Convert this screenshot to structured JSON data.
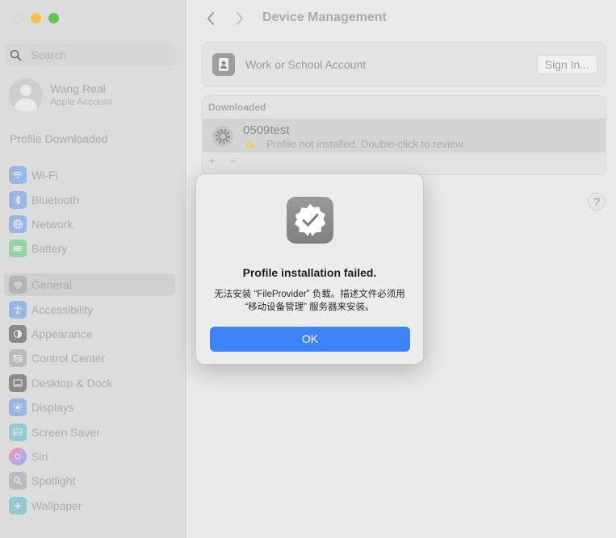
{
  "sidebar": {
    "search_placeholder": "Search",
    "account_name": "Wang Real",
    "account_sub": "Apple Account",
    "profile_downloaded": "Profile Downloaded",
    "items": [
      {
        "label": "Wi-Fi",
        "icon": "wifi-icon",
        "color": "#3b82f6"
      },
      {
        "label": "Bluetooth",
        "icon": "bluetooth-icon",
        "color": "#3b82f6"
      },
      {
        "label": "Network",
        "icon": "globe-icon",
        "color": "#3b82f6"
      },
      {
        "label": "Battery",
        "icon": "battery-icon",
        "color": "#34c759"
      },
      {
        "label": "General",
        "icon": "gear-icon",
        "color": "#8e8e93"
      },
      {
        "label": "Accessibility",
        "icon": "accessibility-icon",
        "color": "#3b82f6"
      },
      {
        "label": "Appearance",
        "icon": "appearance-icon",
        "color": "#1c1c1e"
      },
      {
        "label": "Control Center",
        "icon": "control-center-icon",
        "color": "#8e8e93"
      },
      {
        "label": "Desktop & Dock",
        "icon": "dock-icon",
        "color": "#1c1c1e"
      },
      {
        "label": "Displays",
        "icon": "sun-icon",
        "color": "#3b82f6"
      },
      {
        "label": "Screen Saver",
        "icon": "screen-saver-icon",
        "color": "#30b0c7"
      },
      {
        "label": "Siri",
        "icon": "siri-icon",
        "color": "#af52de"
      },
      {
        "label": "Spotlight",
        "icon": "spotlight-icon",
        "color": "#8e8e93"
      },
      {
        "label": "Wallpaper",
        "icon": "wallpaper-icon",
        "color": "#30b0c7"
      }
    ]
  },
  "main": {
    "title": "Device Management",
    "account_row": {
      "label": "Work or School Account",
      "button": "Sign In..."
    },
    "downloaded": {
      "header": "Downloaded",
      "profile_name": "0509test",
      "profile_status": "Profile not installed. Double-click to review."
    },
    "help": "?"
  },
  "dialog": {
    "title": "Profile installation failed.",
    "message": "无法安装 “FileProvider” 负载。描述文件必须用 “移动设备管理” 服务器来安装。",
    "ok": "OK"
  }
}
